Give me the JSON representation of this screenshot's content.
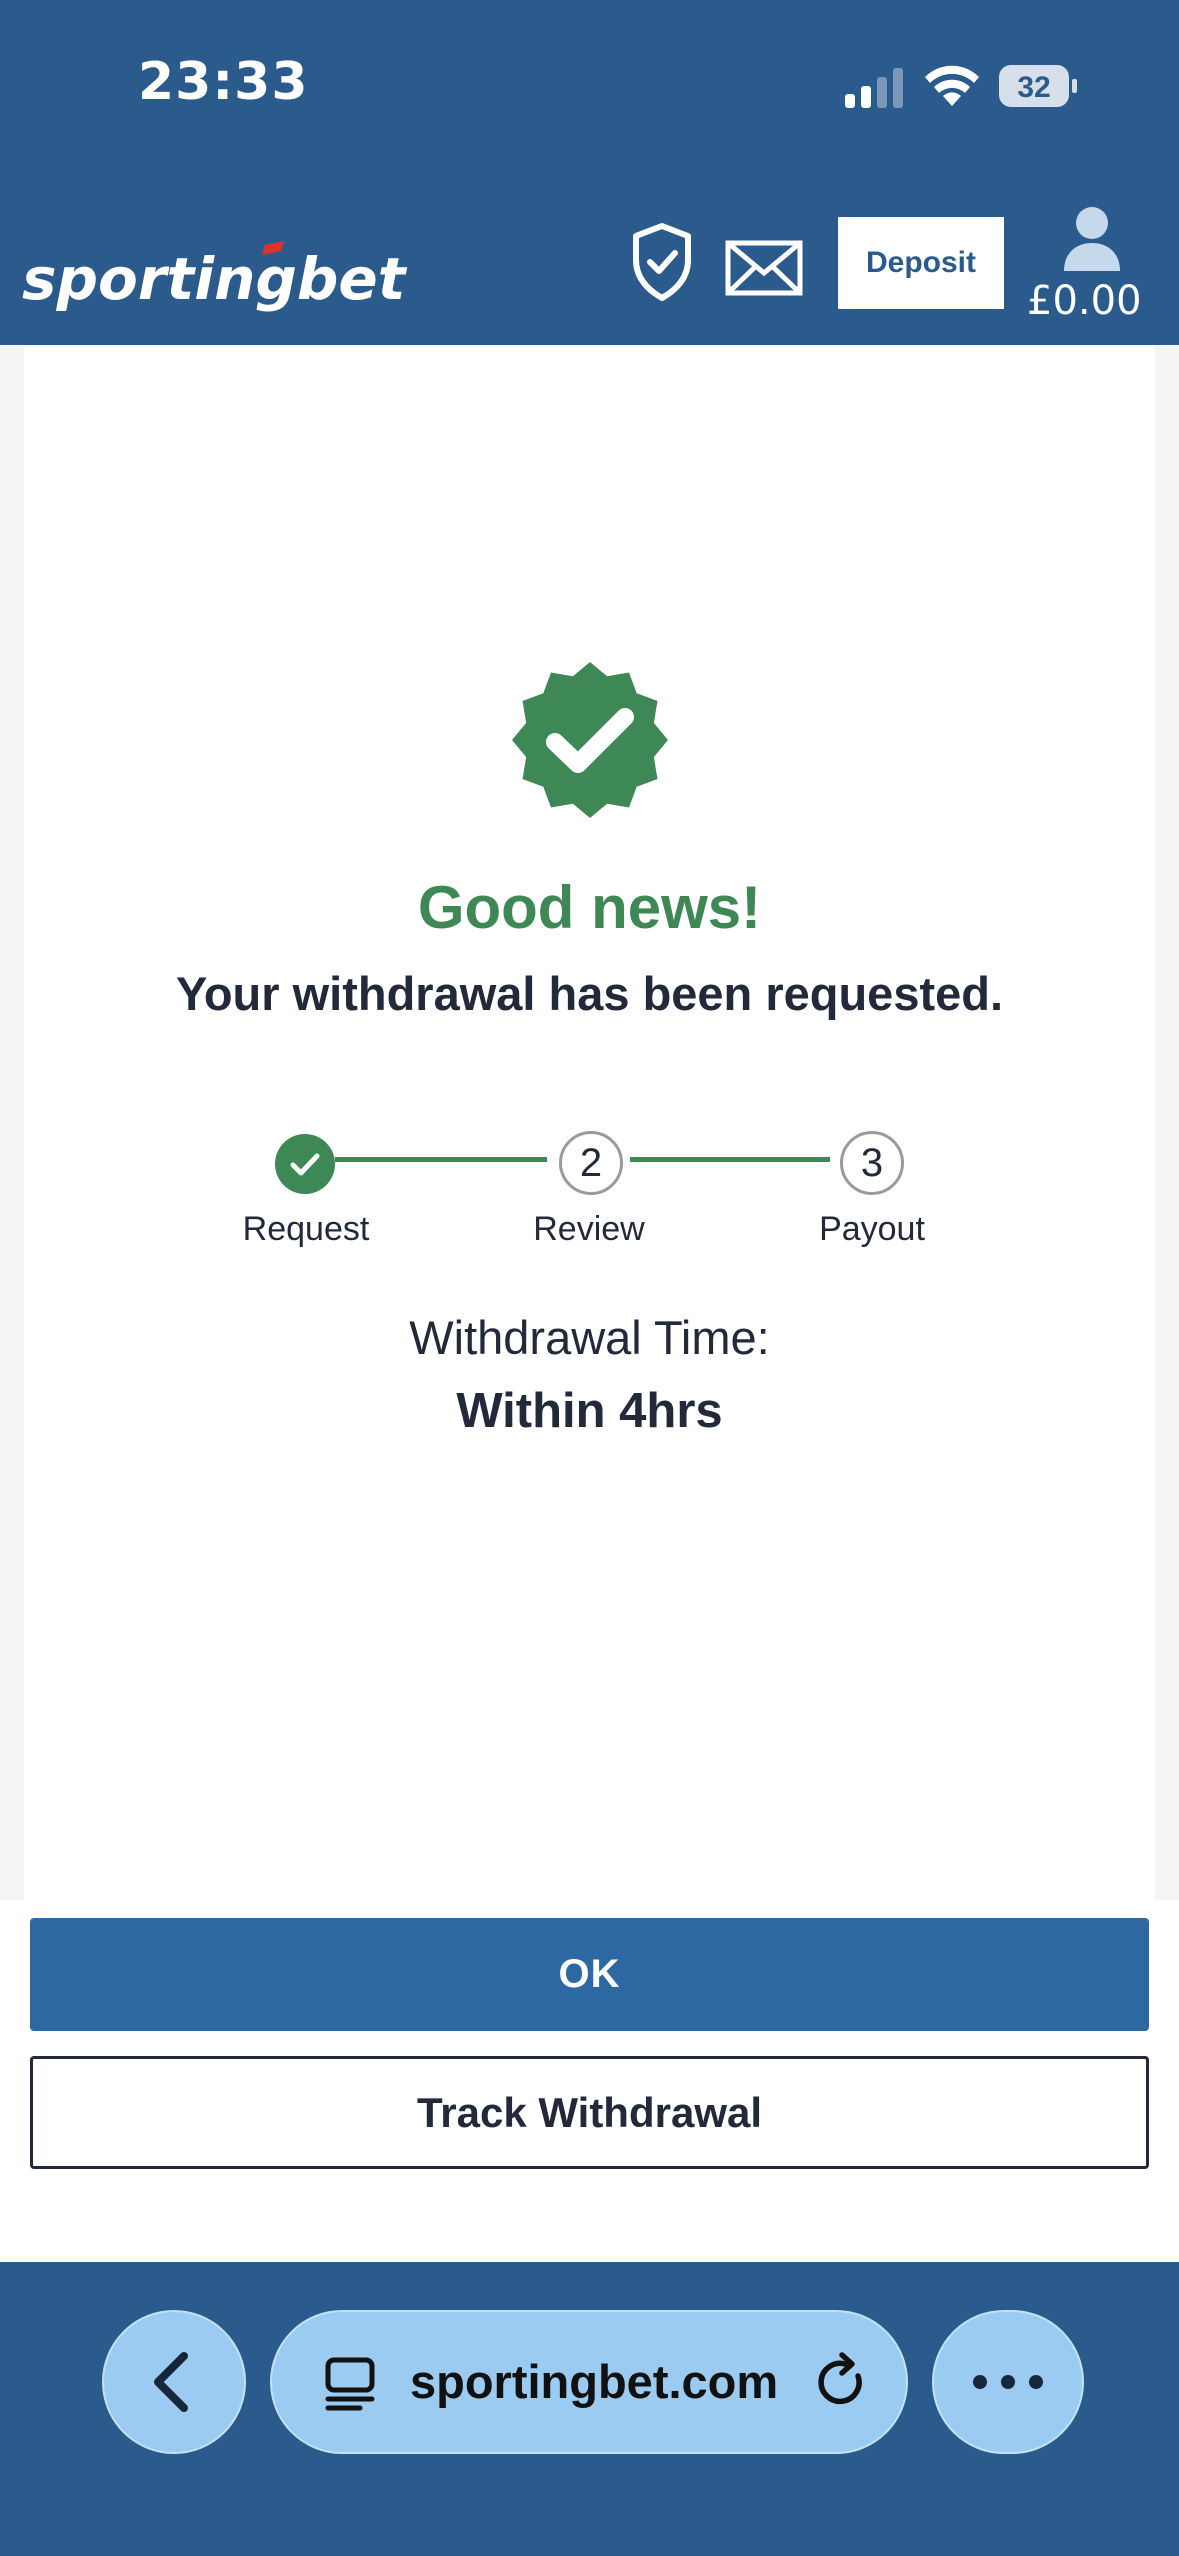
{
  "status_bar": {
    "time": "23:33",
    "battery": "32"
  },
  "header": {
    "logo_text": "sportingbet",
    "deposit_label": "Deposit",
    "balance": "£0.00"
  },
  "confirmation": {
    "headline": "Good news!",
    "message": "Your withdrawal has been requested.",
    "steps": [
      {
        "label": "Request",
        "number": "1",
        "done": true
      },
      {
        "label": "Review",
        "number": "2",
        "done": false
      },
      {
        "label": "Payout",
        "number": "3",
        "done": false
      }
    ],
    "time_label": "Withdrawal Time:",
    "time_value": "Within 4hrs"
  },
  "actions": {
    "ok_label": "OK",
    "track_label": "Track Withdrawal"
  },
  "browser": {
    "url": "sportingbet.com"
  },
  "colors": {
    "brand_blue": "#2b5b8d",
    "success_green": "#3e8855",
    "button_blue": "#2e68a3",
    "browser_pill": "#9bcbf1"
  }
}
